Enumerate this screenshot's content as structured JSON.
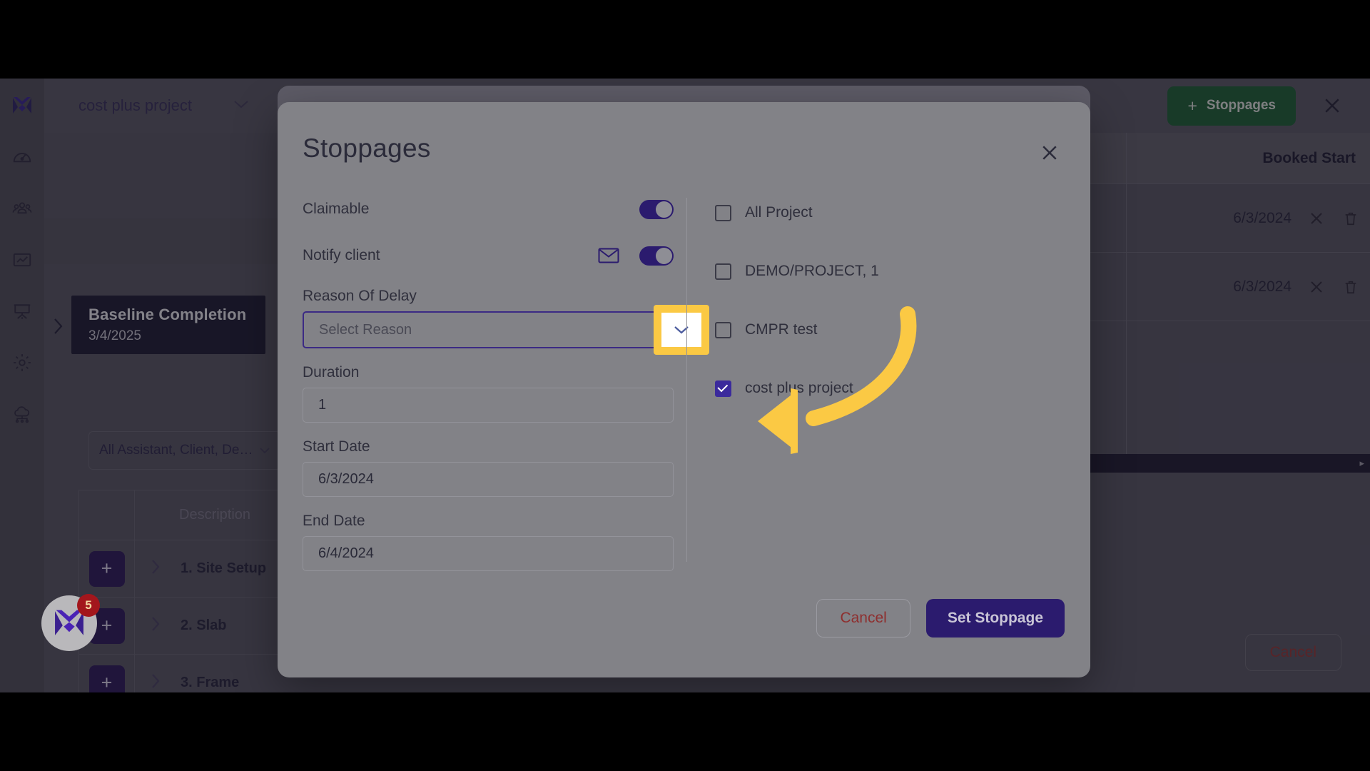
{
  "app": {
    "sidebar": {
      "items": [
        {
          "icon": "logo-m-icon",
          "label": ""
        },
        {
          "icon": "dashboard-gauge-icon",
          "label": ""
        },
        {
          "icon": "team-people-icon",
          "label": ""
        },
        {
          "icon": "chart-trend-icon",
          "label": ""
        },
        {
          "icon": "presentation-board-icon",
          "label": ""
        },
        {
          "icon": "gear-settings-icon",
          "label": ""
        },
        {
          "icon": "cloud-network-icon",
          "label": ""
        }
      ]
    },
    "topbar": {
      "project_name": "cost plus project",
      "project_chevron": "chevron-down-icon",
      "add_stoppages_label": "Stoppages",
      "add_stoppages_plus": "+",
      "close_icon": "close-x-icon"
    },
    "baseline": {
      "title": "Baseline Completion",
      "date": "3/4/2025",
      "expand_icon": "chevron-right-icon"
    },
    "filter": {
      "value": "All Assistant, Client, De…",
      "chevron": "chevron-down-icon"
    },
    "task_table": {
      "columns": [
        "",
        "Description"
      ],
      "rows": [
        {
          "add": "+",
          "chevron": "chevron-right-icon",
          "description": "1. Site Setup"
        },
        {
          "add": "+",
          "chevron": "chevron-right-icon",
          "description": "2. Slab"
        },
        {
          "add": "+",
          "chevron": "chevron-right-icon",
          "description": "3. Frame"
        }
      ]
    },
    "right_table": {
      "header": "Booked Start",
      "rows": [
        {
          "date": "6/3/2024",
          "remove_icon": "close-x-icon",
          "delete_icon": "trash-icon"
        },
        {
          "date": "6/3/2024",
          "remove_icon": "close-x-icon",
          "delete_icon": "trash-icon"
        }
      ],
      "scroll_arrow": "▸"
    },
    "bottom_cancel_label": "Cancel",
    "fab": {
      "icon": "logo-m-icon",
      "badge": "5"
    }
  },
  "modal": {
    "title": "Stoppages",
    "close_icon": "close-x-icon",
    "fields": {
      "claimable": {
        "label": "Claimable",
        "toggle_state": "on"
      },
      "notify_client": {
        "label": "Notify client",
        "mail_icon": "mail-envelope-icon",
        "toggle_state": "on"
      },
      "reason_of_delay": {
        "label": "Reason Of Delay",
        "placeholder": "Select Reason",
        "value": "",
        "chevron": "chevron-down-icon"
      },
      "duration": {
        "label": "Duration",
        "value": "1"
      },
      "start_date": {
        "label": "Start Date",
        "value": "6/3/2024"
      },
      "end_date": {
        "label": "End Date",
        "value": "6/4/2024"
      }
    },
    "projects": [
      {
        "label": "All Project",
        "checked": false
      },
      {
        "label": "DEMO/PROJECT, 1",
        "checked": false
      },
      {
        "label": "CMPR test",
        "checked": false
      },
      {
        "label": "cost plus project",
        "checked": true
      }
    ],
    "actions": {
      "cancel_label": "Cancel",
      "submit_label": "Set Stoppage"
    }
  },
  "annotation": {
    "arrow_color": "#fbc944",
    "highlight_color": "#fbc944",
    "target": "reason-of-delay-dropdown-toggle"
  },
  "colors": {
    "primary_purple": "#2b1b6e",
    "accent_yellow": "#fbc944",
    "green_button": "#14532b",
    "danger_red": "#8e2f2f",
    "modal_bg": "#828287"
  }
}
